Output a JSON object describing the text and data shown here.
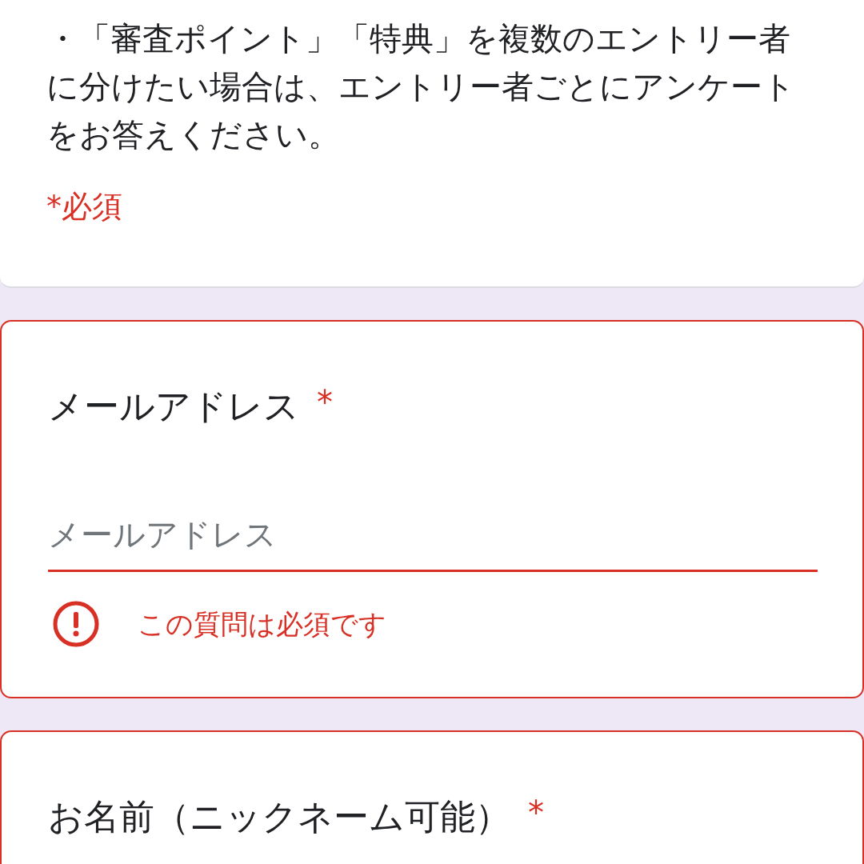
{
  "intro": {
    "text": "・「審査ポイント」「特典」を複数のエントリー者に分けたい場合は、エントリー者ごとにアンケートをお答えください。",
    "required_note": "*必須"
  },
  "questions": [
    {
      "title": "メールアドレス",
      "required": true,
      "required_mark": "*",
      "error": true,
      "placeholder": "メールアドレス",
      "error_message": "この質問は必須です"
    },
    {
      "title": "お名前（ニックネーム可能）",
      "required": true,
      "required_mark": "*",
      "error": true
    }
  ]
}
